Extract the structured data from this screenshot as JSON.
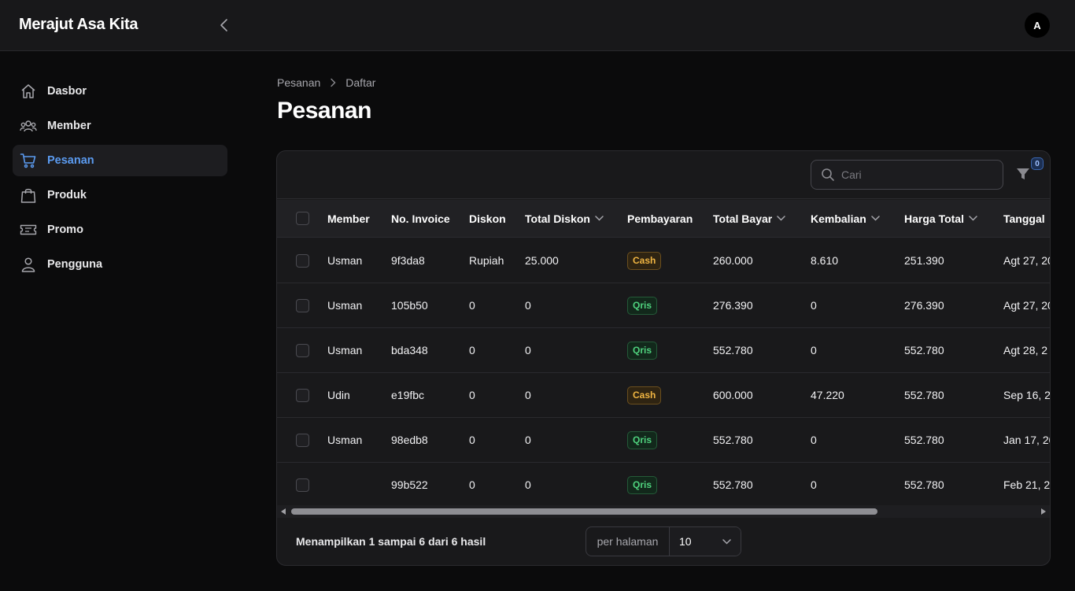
{
  "app": {
    "title": "Merajut Asa Kita",
    "user_initial": "A"
  },
  "sidebar": {
    "items": [
      {
        "label": "Dasbor",
        "icon": "home-icon",
        "active": false
      },
      {
        "label": "Member",
        "icon": "users-icon",
        "active": false
      },
      {
        "label": "Pesanan",
        "icon": "cart-icon",
        "active": true
      },
      {
        "label": "Produk",
        "icon": "bag-icon",
        "active": false
      },
      {
        "label": "Promo",
        "icon": "ticket-icon",
        "active": false
      },
      {
        "label": "Pengguna",
        "icon": "user-icon",
        "active": false
      }
    ]
  },
  "breadcrumb": [
    "Pesanan",
    "Daftar"
  ],
  "page_title": "Pesanan",
  "toolbar": {
    "search_placeholder": "Cari",
    "filter_count": "0"
  },
  "table": {
    "columns": [
      "Member",
      "No. Invoice",
      "Diskon",
      "Total Diskon",
      "Pembayaran",
      "Total Bayar",
      "Kembalian",
      "Harga Total",
      "Tanggal"
    ],
    "rows": [
      {
        "member": "Usman",
        "invoice": "9f3da8",
        "diskon": "Rupiah",
        "total_diskon": "25.000",
        "pembayaran": "Cash",
        "total_bayar": "260.000",
        "kembalian": "8.610",
        "harga_total": "251.390",
        "tanggal": "Agt 27, 20"
      },
      {
        "member": "Usman",
        "invoice": "105b50",
        "diskon": "0",
        "total_diskon": "0",
        "pembayaran": "Qris",
        "total_bayar": "276.390",
        "kembalian": "0",
        "harga_total": "276.390",
        "tanggal": "Agt 27, 20"
      },
      {
        "member": "Usman",
        "invoice": "bda348",
        "diskon": "0",
        "total_diskon": "0",
        "pembayaran": "Qris",
        "total_bayar": "552.780",
        "kembalian": "0",
        "harga_total": "552.780",
        "tanggal": "Agt 28, 2"
      },
      {
        "member": "Udin",
        "invoice": "e19fbc",
        "diskon": "0",
        "total_diskon": "0",
        "pembayaran": "Cash",
        "total_bayar": "600.000",
        "kembalian": "47.220",
        "harga_total": "552.780",
        "tanggal": "Sep 16, 2"
      },
      {
        "member": "Usman",
        "invoice": "98edb8",
        "diskon": "0",
        "total_diskon": "0",
        "pembayaran": "Qris",
        "total_bayar": "552.780",
        "kembalian": "0",
        "harga_total": "552.780",
        "tanggal": "Jan 17, 20"
      },
      {
        "member": "",
        "invoice": "99b522",
        "diskon": "0",
        "total_diskon": "0",
        "pembayaran": "Qris",
        "total_bayar": "552.780",
        "kembalian": "0",
        "harga_total": "552.780",
        "tanggal": "Feb 21, 2"
      }
    ]
  },
  "footer": {
    "summary": "Menampilkan 1 sampai 6 dari 6 hasil",
    "per_page_label": "per halaman",
    "per_page_value": "10"
  },
  "colors": {
    "accent": "#5b9bf0",
    "cash": "#f0b542",
    "qris": "#4fd27e"
  }
}
